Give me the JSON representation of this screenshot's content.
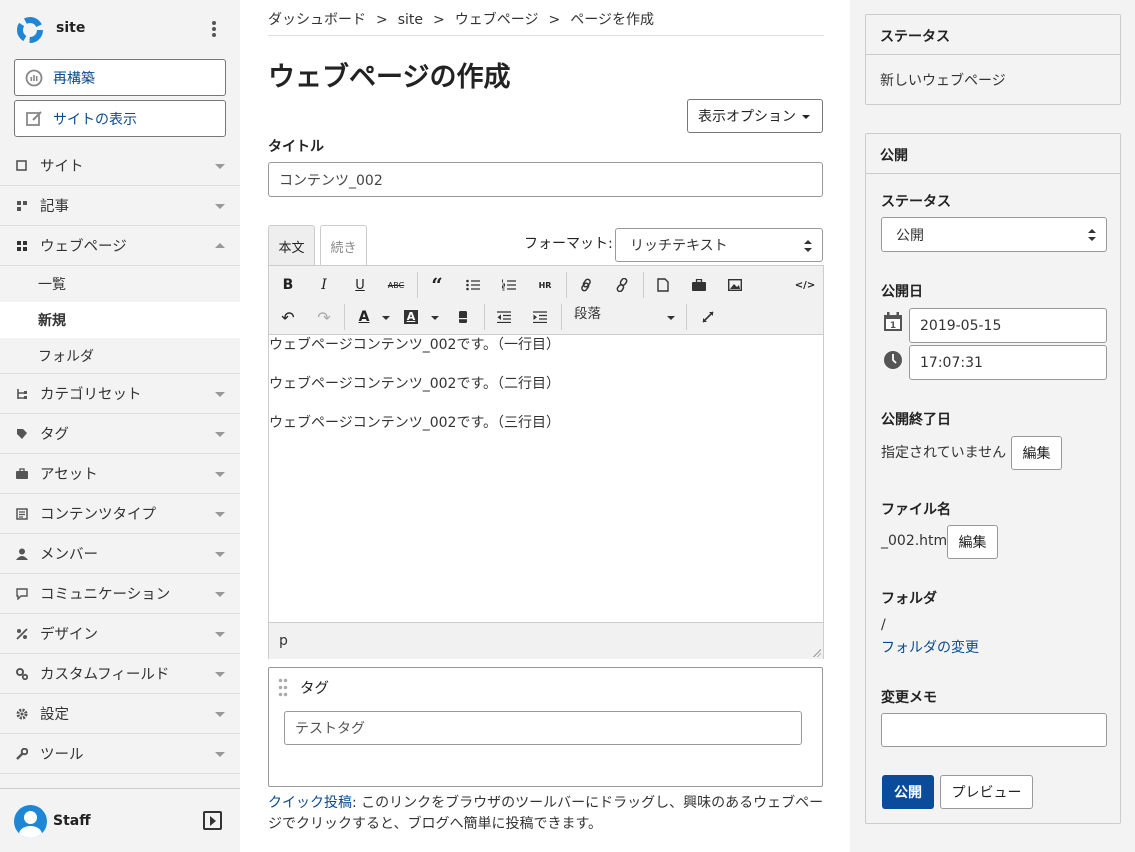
{
  "sidebar": {
    "site_name": "site",
    "rebuild_label": "再構築",
    "view_site_label": "サイトの表示",
    "items": [
      {
        "label": "サイト"
      },
      {
        "label": "記事"
      },
      {
        "label": "ウェブページ"
      },
      {
        "label": "カテゴリセット"
      },
      {
        "label": "タグ"
      },
      {
        "label": "アセット"
      },
      {
        "label": "コンテンツタイプ"
      },
      {
        "label": "メンバー"
      },
      {
        "label": "コミュニケーション"
      },
      {
        "label": "デザイン"
      },
      {
        "label": "カスタムフィールド"
      },
      {
        "label": "設定"
      },
      {
        "label": "ツール"
      }
    ],
    "subitems": [
      {
        "label": "一覧"
      },
      {
        "label": "新規"
      },
      {
        "label": "フォルダ"
      }
    ],
    "user_name": "Staff"
  },
  "breadcrumb": [
    "ダッシュボード",
    ">",
    "site",
    ">",
    "ウェブページ",
    ">",
    "ページを作成"
  ],
  "page_title": "ウェブページの作成",
  "display_options_label": "表示オプション",
  "title_label": "タイトル",
  "title_value": "コンテンツ_002",
  "tabs": {
    "body": "本文",
    "more": "続き"
  },
  "format": {
    "label": "フォーマット:",
    "value": "リッチテキスト"
  },
  "toolbar": {
    "paragraph": "段落"
  },
  "editor_lines": [
    "ウェブページコンテンツ_002です。（一行目）",
    "ウェブページコンテンツ_002です。（二行目）",
    "ウェブページコンテンツ_002です。（三行目）"
  ],
  "editor_status": "p",
  "tags": {
    "label": "タグ",
    "value": "テストタグ"
  },
  "quickpost": {
    "link": "クイック投稿",
    "text": ": このリンクをブラウザのツールバーにドラッグし、興味のあるウェブページでクリックすると、ブログへ簡単に投稿できます。"
  },
  "status_card": {
    "title": "ステータス",
    "value": "新しいウェブページ"
  },
  "publish_card": {
    "title": "公開",
    "status_label": "ステータス",
    "status_value": "公開",
    "date_label": "公開日",
    "date_value": "2019-05-15",
    "time_value": "17:07:31",
    "end_label": "公開終了日",
    "end_value": "指定されていません",
    "edit_label": "編集",
    "filename_label": "ファイル名",
    "filename_value": "_002.html",
    "folder_label": "フォルダ",
    "folder_value": "/",
    "folder_change": "フォルダの変更",
    "memo_label": "変更メモ",
    "publish_btn": "公開",
    "preview_btn": "プレビュー"
  },
  "colors": {
    "accent": "#0a4b9c",
    "link": "#0a4b8c",
    "sidebar_bg": "#f3f3f3"
  }
}
